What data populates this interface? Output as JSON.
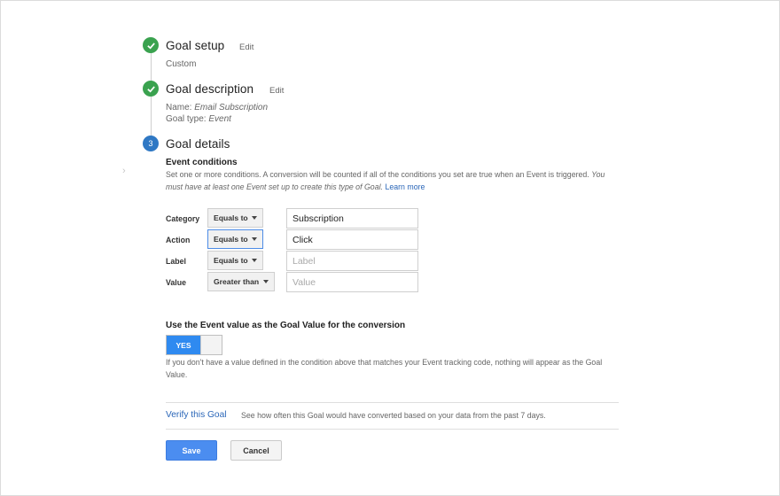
{
  "steps": [
    {
      "title": "Goal setup",
      "edit_label": "Edit",
      "summary": "Custom"
    },
    {
      "title": "Goal description",
      "edit_label": "Edit",
      "name_label": "Name:",
      "name_value": "Email Subscription",
      "type_label": "Goal type:",
      "type_value": "Event"
    },
    {
      "number": "3",
      "title": "Goal details"
    }
  ],
  "event_conditions": {
    "heading": "Event conditions",
    "description": "Set one or more conditions. A conversion will be counted if all of the conditions you set are true when an Event is triggered.",
    "note": "You must have at least one Event set up to create this type of Goal.",
    "learn_more": "Learn more",
    "rows": [
      {
        "label": "Category",
        "operator": "Equals to",
        "value": "Subscription",
        "placeholder": ""
      },
      {
        "label": "Action",
        "operator": "Equals to",
        "value": "Click",
        "placeholder": ""
      },
      {
        "label": "Label",
        "operator": "Equals to",
        "value": "",
        "placeholder": "Label"
      },
      {
        "label": "Value",
        "operator": "Greater than",
        "value": "",
        "placeholder": "Value"
      }
    ]
  },
  "goal_value": {
    "heading": "Use the Event value as the Goal Value for the conversion",
    "toggle_label": "YES",
    "toggle_on": true,
    "help": "If you don't have a value defined in the condition above that matches your Event tracking code, nothing will appear as the Goal Value."
  },
  "verify": {
    "link": "Verify this Goal",
    "description": "See how often this Goal would have converted based on your data from the past 7 days."
  },
  "actions": {
    "save": "Save",
    "cancel": "Cancel"
  },
  "colors": {
    "check_green": "#3aa24f",
    "step_blue": "#2f78c4",
    "accent_blue": "#4b8df0",
    "link_blue": "#2a66b8"
  },
  "icons": {
    "done": "check-icon",
    "side": "chevron-right-icon",
    "dropdown": "caret-down-icon"
  }
}
